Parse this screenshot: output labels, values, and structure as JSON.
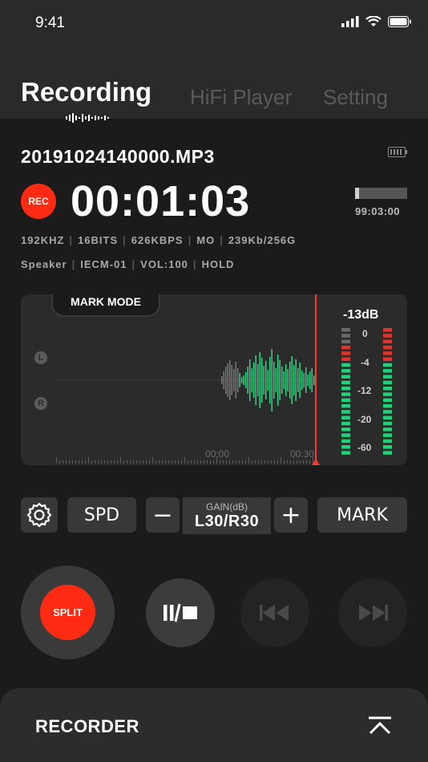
{
  "status_bar": {
    "time": "9:41"
  },
  "tabs": [
    {
      "label": "Recording"
    },
    {
      "label": "HiFi Player"
    },
    {
      "label": "Setting"
    }
  ],
  "recording": {
    "filename": "20191024140000.MP3",
    "rec_label": "REC",
    "timer": "00:01:03",
    "remaining_time": "99:03:00",
    "remaining_fraction": 0.08,
    "info_line1": [
      "192KHZ",
      "16BITS",
      "626KBPS",
      "MO",
      "239Kb/256G"
    ],
    "info_line2": [
      "Speaker",
      "IECM-01",
      "VOL:100",
      "HOLD"
    ]
  },
  "waveform": {
    "mark_mode": "MARK MODE",
    "channel_left": "L",
    "channel_right": "R",
    "level_db": "-13dB",
    "scale": [
      "0",
      "-4",
      "-12",
      "-20",
      "-60"
    ],
    "time_marks": [
      "00:00",
      "00:30"
    ]
  },
  "controls": {
    "spd": "SPD",
    "minus": "−",
    "gain_label": "GAIN(dB)",
    "gain_value": "L30/R30",
    "plus": "+",
    "mark": "MARK"
  },
  "transport": {
    "split": "SPLIT"
  },
  "bottom_sheet": {
    "title": "RECORDER"
  },
  "colors": {
    "accent_red": "#ff2a12",
    "meter_green": "#22d07a",
    "wave_green": "#2fe08a",
    "background": "#1b1b1b"
  }
}
